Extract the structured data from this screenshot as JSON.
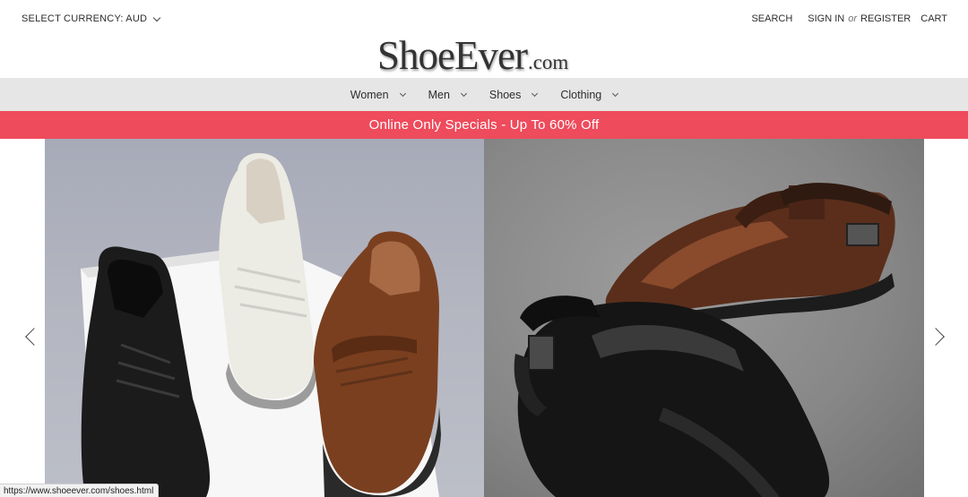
{
  "header": {
    "currency_label": "SELECT CURRENCY: AUD",
    "search_label": "SEARCH",
    "signin_label": "SIGN IN",
    "or_label": "or",
    "register_label": "REGISTER",
    "cart_label": "CART"
  },
  "logo": {
    "main": "ShoeEver",
    "tld": ".com"
  },
  "nav": {
    "items": [
      {
        "label": "Women"
      },
      {
        "label": "Men"
      },
      {
        "label": "Shoes"
      },
      {
        "label": "Clothing"
      }
    ]
  },
  "banner": {
    "text": "Online Only Specials - Up To 60% Off",
    "color": "#ee4b5c"
  },
  "carousel": {
    "prev_icon": "chevron-left-icon",
    "next_icon": "chevron-right-icon"
  },
  "status_bar": {
    "url": "https://www.shoeever.com/shoes.html"
  }
}
